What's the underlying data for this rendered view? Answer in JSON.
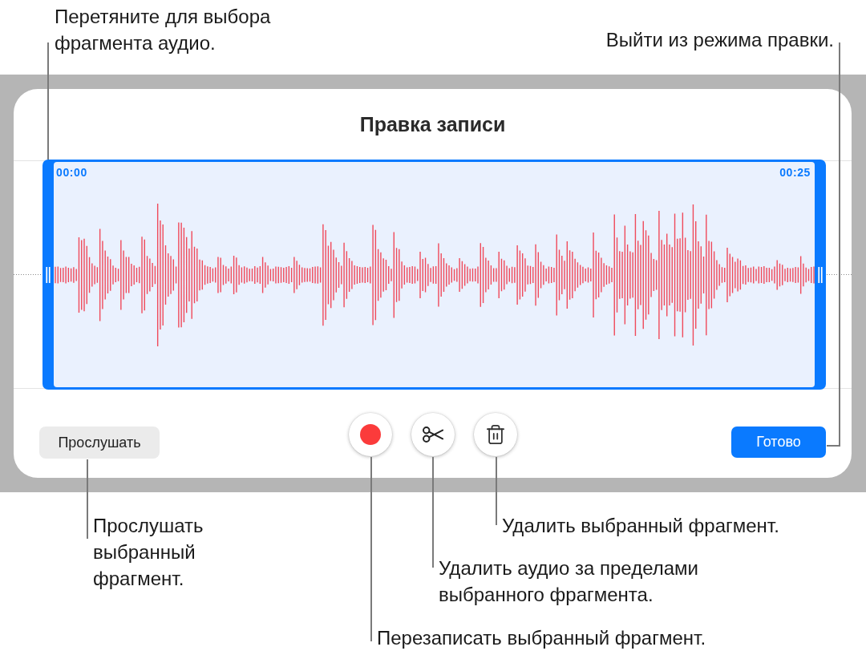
{
  "callouts_above": [
    {
      "lines": [
        "Перетяните для выбора",
        "фрагмента аудио."
      ]
    },
    {
      "lines": [
        "Выйти из режима правки."
      ]
    }
  ],
  "dialog": {
    "title": "Правка записи",
    "selection": {
      "start_time": "00:00",
      "end_time": "00:25"
    },
    "play_button": "Прослушать",
    "tools": [
      {
        "kind": "record"
      },
      {
        "kind": "trim"
      },
      {
        "kind": "delete"
      }
    ],
    "done_button": "Готово"
  },
  "callouts_below": [
    {
      "lines": [
        "Прослушать",
        "выбранный",
        "фрагмент."
      ]
    },
    {
      "lines": [
        "Удалить выбранный фрагмент."
      ]
    },
    {
      "lines": [
        "Удалить аудио за пределами",
        "выбранного фрагмента."
      ]
    },
    {
      "lines": [
        "Перезаписать выбранный фрагмент."
      ]
    }
  ]
}
